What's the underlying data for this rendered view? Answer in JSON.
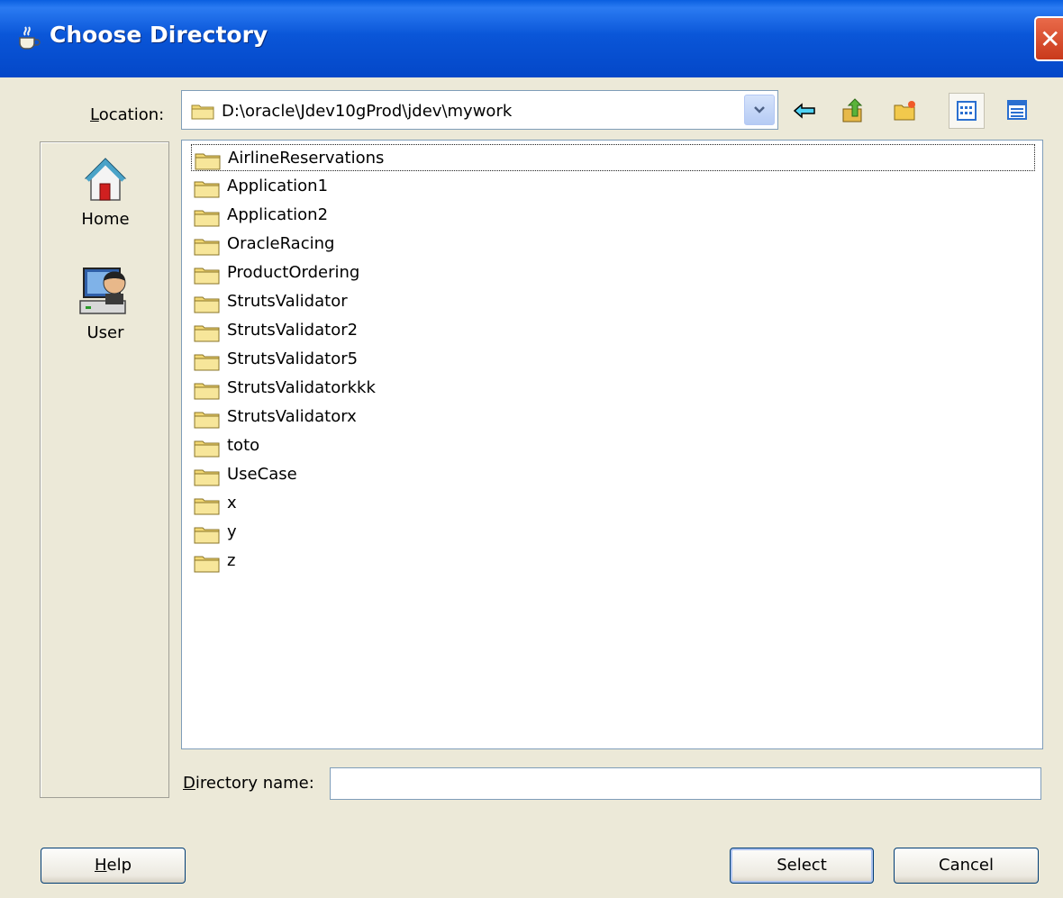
{
  "window": {
    "title": "Choose Directory",
    "close_glyph": "✕"
  },
  "location": {
    "label_accel": "L",
    "label_rest": "ocation:",
    "path": "D:\\oracle\\Jdev10gProd\\jdev\\mywork"
  },
  "toolbar": {
    "icons": [
      "back-arrow-icon",
      "up-folder-icon",
      "new-folder-icon",
      "list-view-icon",
      "details-view-icon"
    ]
  },
  "sidebar": {
    "items": [
      {
        "label": "Home",
        "icon": "home-icon"
      },
      {
        "label": "User",
        "icon": "user-computer-icon"
      }
    ]
  },
  "files": [
    "AirlineReservations",
    "Application1",
    "Application2",
    "OracleRacing",
    "ProductOrdering",
    "StrutsValidator",
    "StrutsValidator2",
    "StrutsValidator5",
    "StrutsValidatorkkk",
    "StrutsValidatorx",
    "toto",
    "UseCase",
    "x",
    "y",
    "z"
  ],
  "directory_name": {
    "label_accel": "D",
    "label_rest": "irectory name:",
    "value": ""
  },
  "buttons": {
    "help_accel": "H",
    "help_rest": "elp",
    "select": "Select",
    "cancel": "Cancel"
  },
  "colors": {
    "titlebar": "#0a56d8",
    "dialog_bg": "#ece9d8",
    "folder": "#f2d873"
  }
}
